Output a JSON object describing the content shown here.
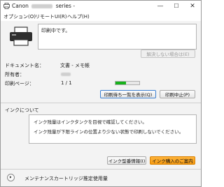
{
  "window": {
    "title_prefix": "Canon",
    "title_suffix": "series -",
    "controls": {
      "minimize": "—",
      "maximize": "☐",
      "close": "✕"
    }
  },
  "menu": {
    "items": [
      "オプション(O)",
      "リモートUI(R)",
      "ヘルプ(H)"
    ]
  },
  "status": {
    "message": "印刷中です。",
    "resolve_button": "解決しない場合は(E)"
  },
  "job": {
    "document_label": "ドキュメント名：",
    "document_value": "文書 - メモ帳",
    "owner_label": "所有者：",
    "pages_label": "印刷ページ：",
    "pages_value": "1 / 1",
    "progress_fraction": 0.45,
    "progress_color": "#17b21b",
    "show_queue_button": "印刷待ち一覧を表示(Q)",
    "cancel_button": "印刷中止(P)"
  },
  "ink": {
    "section_title": "インクについて",
    "lines": [
      "インク残量はインクタンクを目視で確認してください。",
      "インク残量が下限ラインの位置より少ない状態で印刷しないでください。"
    ],
    "model_info_button": "インク型番情報(I)",
    "buy_button": "インク購入のご案内",
    "buy_button_color": "#f59a12"
  },
  "footer": {
    "maintenance_label": "メンテナンスカートリッジ推定使用量"
  }
}
